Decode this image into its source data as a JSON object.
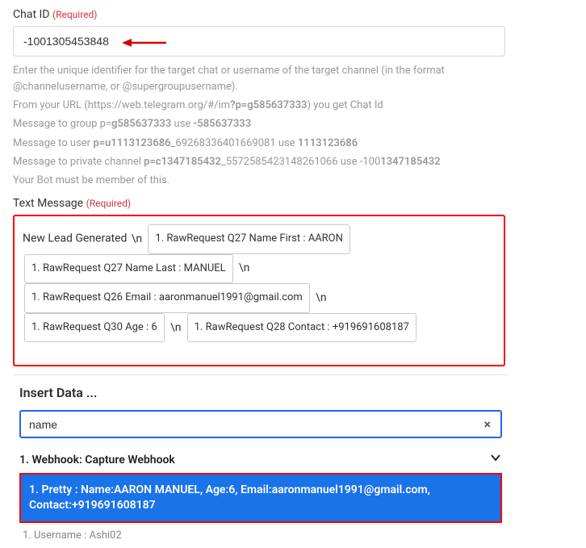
{
  "chatId": {
    "label": "Chat ID",
    "required": "(Required)",
    "value": "-1001305453848",
    "help": {
      "l1a": "Enter the unique identifier for the target chat or username of the target channel (in the format @channelusername, or @supergroupusername).",
      "l2a": "From your URL (https://web.telegram.org/#/im",
      "l2b": "?p=g585637333",
      "l2c": ") you get Chat Id",
      "l3a": "Message to group p=",
      "l3b": "g585637333",
      "l3c": " use ",
      "l3d": "-585637333",
      "l4a": "Message to user ",
      "l4b": "p=u1113123686",
      "l4c": "_6926833640166908",
      "l4d": "1 use ",
      "l4e": "1113123686",
      "l5a": "Message to private channel ",
      "l5b": "p=c1347185432",
      "l5c": "_5572585423148261066 use -100",
      "l5d": "1347185432",
      "l6": "Your Bot must be member of this."
    }
  },
  "textMessage": {
    "label": "Text Message",
    "required": "(Required)",
    "prefix": "New Lead Generated",
    "nl": "\\n",
    "pills": {
      "p1": "1. RawRequest Q27 Name First : AARON",
      "p2": "1. RawRequest Q27 Name Last : MANUEL",
      "p3": "1. RawRequest Q26 Email : aaronmanuel1991@gmail.com",
      "p4": "1. RawRequest Q30 Age : 6",
      "p5": "1. RawRequest Q28 Contact : +919691608187"
    }
  },
  "insert": {
    "title": "Insert Data ...",
    "search": "name",
    "sectionTitle": "1. Webhook: Capture Webhook",
    "result1": "1. Pretty : Name:AARON MANUEL, Age:6, Email:aaronmanuel1991@gmail.com, Contact:+919691608187",
    "result2": "1. Username : Ashi02"
  }
}
